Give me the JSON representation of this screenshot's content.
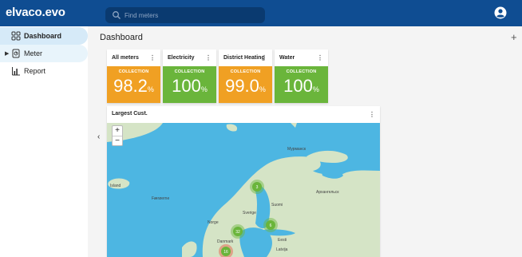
{
  "app": {
    "logo": "elvaco.evo"
  },
  "search": {
    "placeholder": "Find meters"
  },
  "sidebar": {
    "items": [
      {
        "label": "Dashboard"
      },
      {
        "label": "Meter"
      },
      {
        "label": "Report"
      }
    ]
  },
  "main": {
    "title": "Dashboard",
    "add_symbol": "+",
    "collapse_symbol": "‹"
  },
  "cards": [
    {
      "title": "All meters",
      "status": "COLLECTION",
      "value": "98.2",
      "unit": "%",
      "color": "#f0a023"
    },
    {
      "title": "Electricity",
      "status": "COLLECTION",
      "value": "100",
      "unit": "%",
      "color": "#6ab53b"
    },
    {
      "title": "District Heating",
      "status": "COLLECTION",
      "value": "99.0",
      "unit": "%",
      "color": "#f0a023"
    },
    {
      "title": "Water",
      "status": "COLLECTION",
      "value": "100",
      "unit": "%",
      "color": "#6ab53b"
    }
  ],
  "map": {
    "title": "Largest Cust.",
    "zoom_in": "+",
    "zoom_out": "−",
    "clusters": [
      {
        "count": "3"
      },
      {
        "count": "32"
      },
      {
        "count": "6"
      },
      {
        "count": "16"
      }
    ],
    "place_labels": [
      "Island",
      "Færøerne",
      "Norge",
      "Sverige",
      "Suomi",
      "Eesti",
      "Latvija",
      "Danmark",
      "Мурманск",
      "Архангельск"
    ]
  },
  "colors": {
    "topbar": "#0f4d92",
    "orange": "#f0a023",
    "green": "#6ab53b",
    "sea": "#4db6e2",
    "land": "#d5e4c6"
  }
}
